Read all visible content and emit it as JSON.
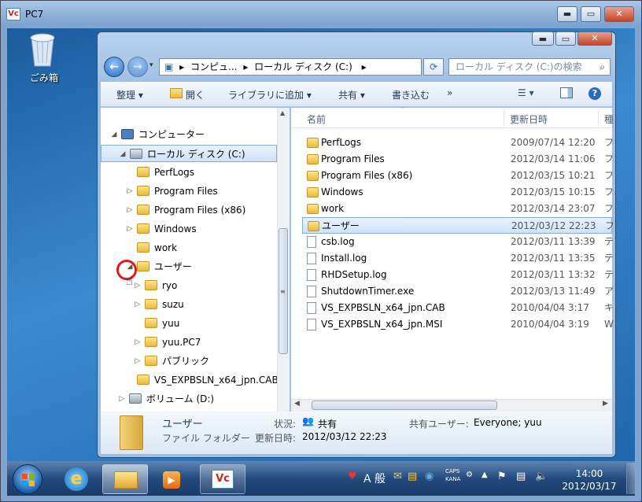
{
  "vnc": {
    "title": "PC7",
    "logo": "Vc",
    "min": "▬",
    "max": "▭",
    "close": "✕"
  },
  "desktop": {
    "recycle_bin_label": "ごみ箱"
  },
  "explorer": {
    "address": {
      "crumb1": "コンピュ...",
      "crumb2": "ローカル ディスク (C:)",
      "sep": "▸",
      "search_placeholder": "ローカル ディスク (C:)の検索"
    },
    "toolbar": {
      "organize": "整理 ▾",
      "open": "開く",
      "add_to_library": "ライブラリに追加 ▾",
      "share": "共有 ▾",
      "burn": "書き込む",
      "more": "»"
    },
    "nav": [
      {
        "label": "コンピューター",
        "indent": 0,
        "exp": "◢"
      },
      {
        "label": "ローカル ディスク (C:)",
        "indent": 1,
        "exp": "◢",
        "selected": true
      },
      {
        "label": "PerfLogs",
        "indent": 2,
        "exp": ""
      },
      {
        "label": "Program Files",
        "indent": 2,
        "exp": "▷"
      },
      {
        "label": "Program Files (x86)",
        "indent": 2,
        "exp": "▷"
      },
      {
        "label": "Windows",
        "indent": 2,
        "exp": "▷"
      },
      {
        "label": "work",
        "indent": 2,
        "exp": ""
      },
      {
        "label": "ユーザー",
        "indent": 2,
        "exp": "◢"
      },
      {
        "label": "ryo",
        "indent": 3,
        "exp": "▷"
      },
      {
        "label": "suzu",
        "indent": 3,
        "exp": "▷"
      },
      {
        "label": "yuu",
        "indent": 3,
        "exp": ""
      },
      {
        "label": "yuu.PC7",
        "indent": 3,
        "exp": "▷"
      },
      {
        "label": "パブリック",
        "indent": 3,
        "exp": "▷"
      },
      {
        "label": "VS_EXPBSLN_x64_jpn.CAB",
        "indent": 2,
        "exp": ""
      },
      {
        "label": "ボリューム (D:)",
        "indent": 1,
        "exp": "▷"
      }
    ],
    "columns": {
      "name": "名前",
      "date": "更新日時",
      "type": "種"
    },
    "files": [
      {
        "name": "PerfLogs",
        "date": "2009/07/14 12:20",
        "type": "フ",
        "kind": "folder"
      },
      {
        "name": "Program Files",
        "date": "2012/03/14 11:06",
        "type": "フ",
        "kind": "folder"
      },
      {
        "name": "Program Files (x86)",
        "date": "2012/03/15 10:21",
        "type": "フ",
        "kind": "folder"
      },
      {
        "name": "Windows",
        "date": "2012/03/15 10:15",
        "type": "フ",
        "kind": "folder"
      },
      {
        "name": "work",
        "date": "2012/03/14 23:07",
        "type": "フ",
        "kind": "folder"
      },
      {
        "name": "ユーザー",
        "date": "2012/03/12 22:23",
        "type": "フ",
        "kind": "folder",
        "selected": true
      },
      {
        "name": "csb.log",
        "date": "2012/03/11 13:39",
        "type": "テ",
        "kind": "file"
      },
      {
        "name": "Install.log",
        "date": "2012/03/11 13:35",
        "type": "テ",
        "kind": "file"
      },
      {
        "name": "RHDSetup.log",
        "date": "2012/03/11 13:32",
        "type": "テ",
        "kind": "file"
      },
      {
        "name": "ShutdownTimer.exe",
        "date": "2012/03/13 11:49",
        "type": "ア",
        "kind": "file"
      },
      {
        "name": "VS_EXPBSLN_x64_jpn.CAB",
        "date": "2010/04/04 3:17",
        "type": "キ",
        "kind": "file"
      },
      {
        "name": "VS_EXPBSLN_x64_jpn.MSI",
        "date": "2010/04/04 3:19",
        "type": "W",
        "kind": "file"
      }
    ],
    "details": {
      "name": "ユーザー",
      "type": "ファイル フォルダー",
      "state_label": "状況:",
      "state_value": "共有",
      "shared_users_label": "共有ユーザー:",
      "shared_users_value": "Everyone; yuu",
      "modified_label": "更新日時:",
      "modified_value": "2012/03/12 22:23"
    }
  },
  "taskbar": {
    "time": "14:00",
    "date": "2012/03/17",
    "ime": "A 般",
    "caps": "CAPS",
    "kana": "KANA"
  }
}
